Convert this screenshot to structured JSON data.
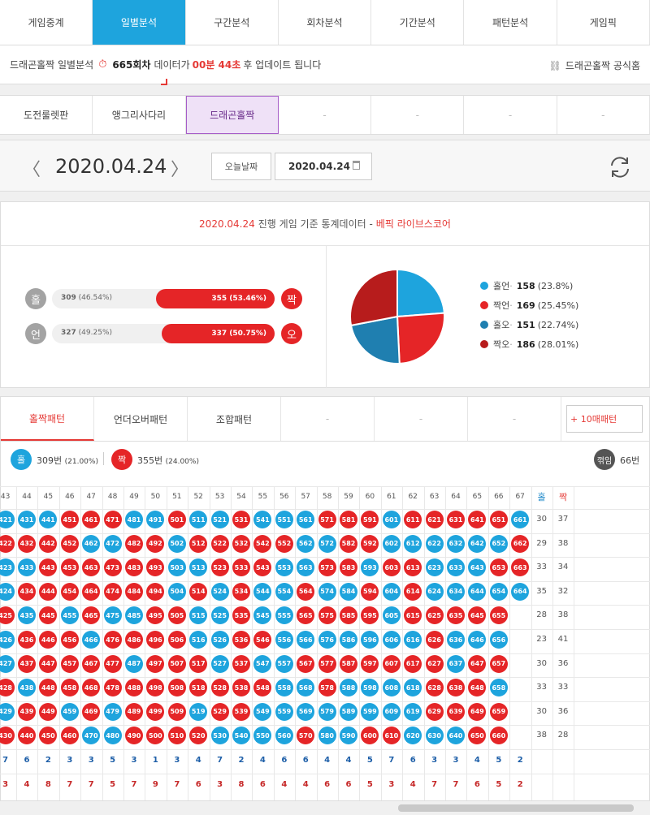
{
  "topnav": [
    {
      "label": "게임중계",
      "active": false
    },
    {
      "label": "일별분석",
      "active": true
    },
    {
      "label": "구간분석",
      "active": false
    },
    {
      "label": "회차분석",
      "active": false
    },
    {
      "label": "기간분석",
      "active": false
    },
    {
      "label": "패턴분석",
      "active": false
    },
    {
      "label": "게임픽",
      "active": false
    }
  ],
  "notice": {
    "prefix": "드래곤홀짝 일별분석",
    "round": "665회차",
    "mid": "데이터가",
    "timer": "00분 44초",
    "suffix": "후 업데이트 됩니다",
    "official": "드래곤홀짝 공식홈"
  },
  "subnav": [
    "도전룰렛판",
    "앵그리사다리",
    "드래곤홀짝",
    "-",
    "-",
    "-",
    "-"
  ],
  "subnav_active": 2,
  "datebar": {
    "date": "2020.04.24",
    "today_btn": "오늘날짜",
    "date_input": "2020.04.24"
  },
  "stats": {
    "title_date": "2020.04.24",
    "title_mid": "진행 게임 기준 통계데이터 -",
    "title_source": "베픽 라이브스코어",
    "rows": [
      {
        "left_label": "홀",
        "left_value": "309",
        "left_pct": "(46.54%)",
        "right_value": "355",
        "right_pct": "(53.46%)",
        "right_label": "짝",
        "right_fraction": 0.5346
      },
      {
        "left_label": "언",
        "left_value": "327",
        "left_pct": "(49.25%)",
        "right_value": "337",
        "right_pct": "(50.75%)",
        "right_label": "오",
        "right_fraction": 0.5075
      }
    ],
    "pie": [
      {
        "label": "홀언",
        "value": 158,
        "pct": "(23.8%)",
        "color": "#1ea4dd"
      },
      {
        "label": "짝언",
        "value": 169,
        "pct": "(25.45%)",
        "color": "#e52527"
      },
      {
        "label": "홀오",
        "value": 151,
        "pct": "(22.74%)",
        "color": "#1f7fb0"
      },
      {
        "label": "짝오",
        "value": 186,
        "pct": "(28.01%)",
        "color": "#b71c1c"
      }
    ]
  },
  "pattern": {
    "tabs": [
      "홀짝패턴",
      "언더오버패턴",
      "조합패턴",
      "-",
      "-",
      "-"
    ],
    "ten_btn": "+ 10매패턴",
    "odd_label": "홀",
    "odd_text": "309번",
    "odd_pct": "(21.00%)",
    "even_label": "짝",
    "even_text": "355번",
    "even_pct": "(24.00%)",
    "broken_label": "꺾임",
    "broken_count": "66번",
    "col_headers": [
      "43",
      "44",
      "45",
      "46",
      "47",
      "48",
      "49",
      "50",
      "51",
      "52",
      "53",
      "54",
      "55",
      "56",
      "57",
      "58",
      "59",
      "60",
      "61",
      "62",
      "63",
      "64",
      "65",
      "66",
      "67"
    ],
    "stat_headers": [
      "홀",
      "짝"
    ],
    "row_odd": [
      30,
      29,
      33,
      35,
      28,
      23,
      30,
      33,
      30,
      38
    ],
    "row_even": [
      37,
      38,
      34,
      32,
      38,
      41,
      36,
      33,
      36,
      28
    ],
    "col_odd_totals": [
      7,
      6,
      2,
      3,
      3,
      5,
      3,
      1,
      3,
      4,
      7,
      2,
      4,
      6,
      6,
      4,
      4,
      5,
      7,
      6,
      3,
      3,
      4,
      5,
      2
    ],
    "col_even_totals": [
      3,
      4,
      8,
      7,
      7,
      5,
      7,
      9,
      7,
      6,
      3,
      8,
      6,
      4,
      4,
      6,
      6,
      5,
      3,
      4,
      7,
      7,
      6,
      5,
      2
    ],
    "columns": [
      {
        "start": 421,
        "count": 10,
        "seq": "oeooeooeoe"
      },
      {
        "start": 431,
        "count": 10,
        "seq": "oeoeoeeoee"
      },
      {
        "start": 441,
        "count": 10,
        "seq": "oeeeeeeeee"
      },
      {
        "start": 451,
        "count": 10,
        "seq": "eeeeoeeeoe"
      },
      {
        "start": 461,
        "count": 10,
        "seq": "eoeeeoeeeo"
      },
      {
        "start": 471,
        "count": 10,
        "seq": "eoeeoeeeoo"
      },
      {
        "start": 481,
        "count": 10,
        "seq": "oeeeoeoeee"
      },
      {
        "start": 491,
        "count": 10,
        "seq": "oeeeeeeeee"
      },
      {
        "start": 501,
        "count": 10,
        "seq": "eoooeeeeee"
      },
      {
        "start": 511,
        "count": 10,
        "seq": "oeoeooeeoe"
      },
      {
        "start": 521,
        "count": 10,
        "seq": "oeeooooeeo"
      },
      {
        "start": 531,
        "count": 10,
        "seq": "eeeeeeeeeo"
      },
      {
        "start": 541,
        "count": 10,
        "seq": "oeeooeoeoo"
      },
      {
        "start": 551,
        "count": 10,
        "seq": "oeoooooooo"
      },
      {
        "start": 561,
        "count": 10,
        "seq": "oooeeoeooe"
      },
      {
        "start": 571,
        "count": 10,
        "seq": "eoeoeoeeoo"
      },
      {
        "start": 581,
        "count": 10,
        "seq": "eeeoeoeooo"
      },
      {
        "start": 591,
        "count": 10,
        "seq": "eeoeeoeooe"
      },
      {
        "start": 601,
        "count": 10,
        "seq": "ooeoooeooe"
      },
      {
        "start": 611,
        "count": 10,
        "seq": "eoeeeoeooo"
      },
      {
        "start": 621,
        "count": 10,
        "seq": "eoooeeeeeo"
      },
      {
        "start": 631,
        "count": 10,
        "seq": "eoooeooeeo"
      },
      {
        "start": 641,
        "count": 10,
        "seq": "eoooeoeeee"
      },
      {
        "start": 651,
        "count": 10,
        "seq": "eoeoeoeoee"
      },
      {
        "start": 661,
        "count": 4,
        "seq": "oeeo"
      }
    ]
  }
}
